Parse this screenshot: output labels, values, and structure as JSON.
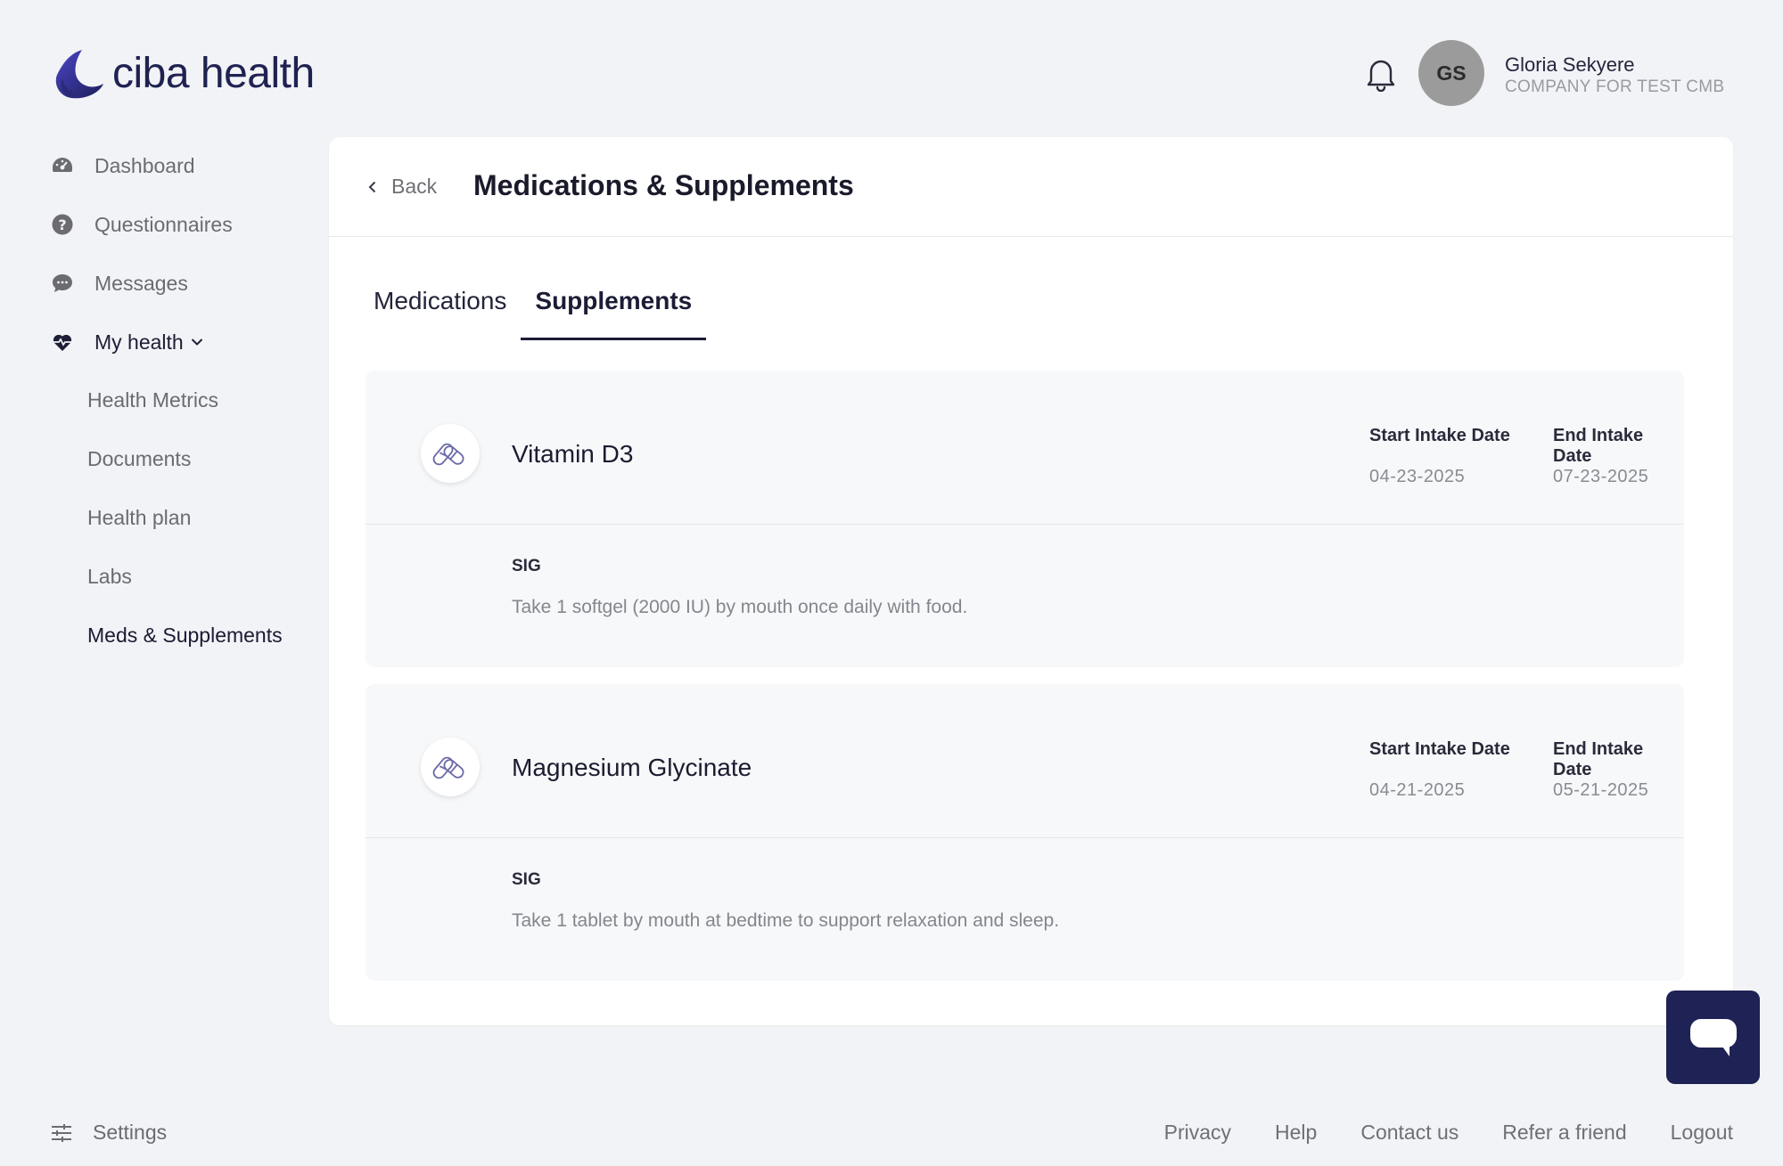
{
  "brand": {
    "name": "ciba health",
    "logo_icon": "ciba-leaf-logo",
    "color": "#1f2251"
  },
  "header": {
    "bell_icon": "bell-icon",
    "avatar_initials": "GS",
    "user_name": "Gloria Sekyere",
    "user_company": "COMPANY FOR TEST CMB"
  },
  "sidebar": {
    "items": [
      {
        "label": "Dashboard",
        "icon": "dashboard-gauge-icon"
      },
      {
        "label": "Questionnaires",
        "icon": "question-circle-icon"
      },
      {
        "label": "Messages",
        "icon": "chat-bubble-icon"
      },
      {
        "label": "My health",
        "icon": "heart-pulse-icon"
      }
    ],
    "sub_items": [
      {
        "label": "Health Metrics"
      },
      {
        "label": "Documents"
      },
      {
        "label": "Health plan"
      },
      {
        "label": "Labs"
      },
      {
        "label": "Meds & Supplements"
      }
    ],
    "settings_label": "Settings"
  },
  "main": {
    "back_label": "Back",
    "title": "Medications & Supplements",
    "tabs": [
      {
        "label": "Medications"
      },
      {
        "label": "Supplements"
      }
    ],
    "supplements": [
      {
        "name": "Vitamin D3",
        "start_label": "Start Intake Date",
        "start_date": "04-23-2025",
        "end_label": "End Intake Date",
        "end_date": "07-23-2025",
        "sig_label": "SIG",
        "sig_text": "Take 1 softgel (2000 IU) by mouth once daily with food."
      },
      {
        "name": "Magnesium Glycinate",
        "start_label": "Start Intake Date",
        "start_date": "04-21-2025",
        "end_label": "End Intake Date",
        "end_date": "05-21-2025",
        "sig_label": "SIG",
        "sig_text": "Take 1 tablet by mouth at bedtime to support relaxation and sleep."
      }
    ]
  },
  "footer": {
    "links": [
      {
        "label": "Privacy"
      },
      {
        "label": "Help"
      },
      {
        "label": "Contact us"
      },
      {
        "label": "Refer a friend"
      },
      {
        "label": "Logout"
      }
    ]
  },
  "colors": {
    "background": "#f1f3f6",
    "panel": "#ffffff",
    "card": "#f7f8fa",
    "accent": "#1f2255"
  }
}
